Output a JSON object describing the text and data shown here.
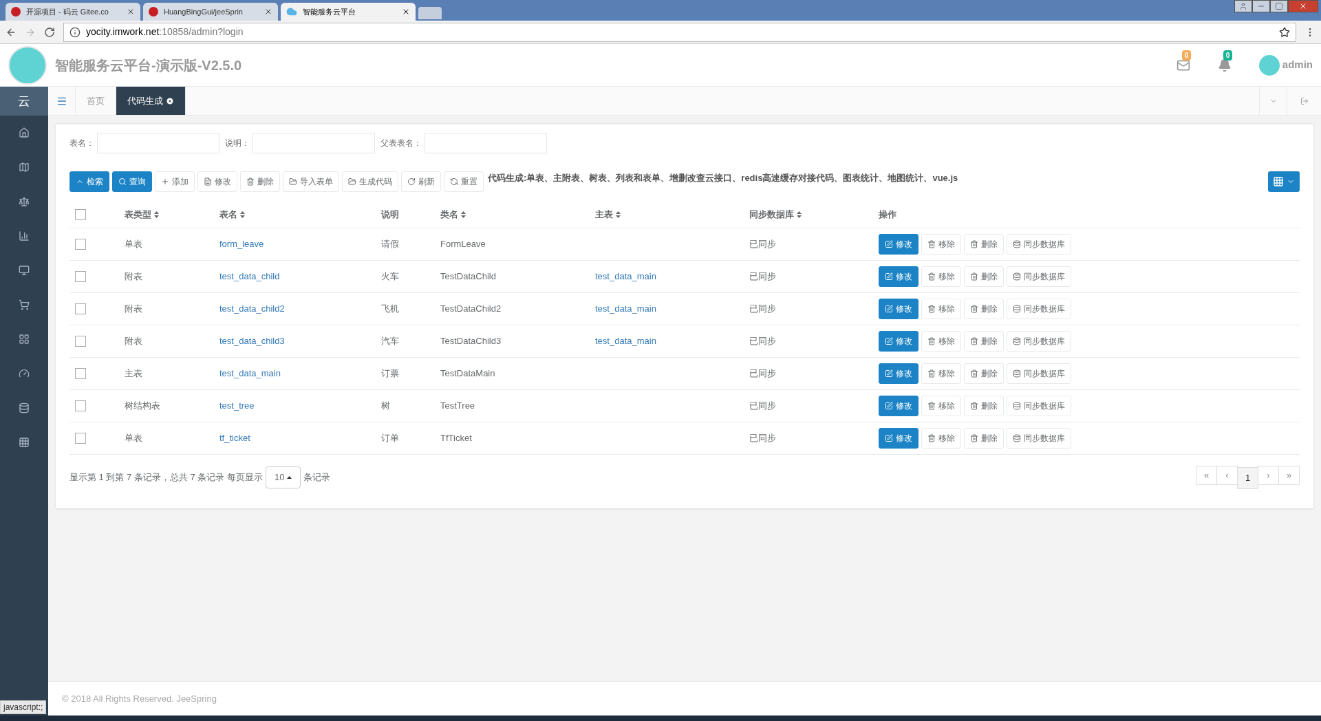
{
  "browser": {
    "tabs": [
      {
        "title": "开源项目 - 码云 Gitee.co",
        "selected": false,
        "kind": "gitee"
      },
      {
        "title": "HuangBingGui/jeeSprin",
        "selected": false,
        "kind": "gitee"
      },
      {
        "title": "智能服务云平台",
        "selected": true,
        "kind": "cloud"
      }
    ],
    "url_host": "yocity.imwork.net",
    "url_rest": ":10858/admin?login"
  },
  "header": {
    "title": "智能服务云平台-演示版-V2.5.0",
    "mail_count": "0",
    "bell_count": "0",
    "user": "admin"
  },
  "sidebar": {
    "brand": "云"
  },
  "page_tabs": [
    {
      "label": "首页",
      "selected": false,
      "closable": false
    },
    {
      "label": "代码生成",
      "selected": true,
      "closable": true
    }
  ],
  "filters": [
    {
      "label": "表名："
    },
    {
      "label": "说明："
    },
    {
      "label": "父表表名："
    }
  ],
  "toolbar": [
    {
      "label": "检索",
      "kind": "primary"
    },
    {
      "label": "查询",
      "kind": "primary"
    },
    {
      "label": "添加",
      "kind": "default"
    },
    {
      "label": "修改",
      "kind": "default"
    },
    {
      "label": "删除",
      "kind": "default"
    },
    {
      "label": "导入表单",
      "kind": "default"
    },
    {
      "label": "生成代码",
      "kind": "default"
    },
    {
      "label": "刷新",
      "kind": "default"
    },
    {
      "label": "重置",
      "kind": "default"
    }
  ],
  "toolbar_note": "代码生成:单表、主附表、树表、列表和表单、增删改查云接口、redis高速缓存对接代码、图表统计、地图统计、vue.js",
  "table": {
    "select_all_checked": false,
    "columns": [
      {
        "label": "表类型",
        "sortable": true
      },
      {
        "label": "表名",
        "sortable": true
      },
      {
        "label": "说明",
        "sortable": false
      },
      {
        "label": "类名",
        "sortable": true
      },
      {
        "label": "主表",
        "sortable": true
      },
      {
        "label": "同步数据库",
        "sortable": true
      },
      {
        "label": "操作",
        "sortable": false
      }
    ],
    "rows": [
      {
        "checked": false,
        "type": "单表",
        "name": "form_leave",
        "comment": "请假",
        "class": "FormLeave",
        "parent": "",
        "sync": "已同步",
        "actions": [
          {
            "label": "修改",
            "kind": "primary"
          },
          {
            "label": "移除",
            "kind": "default"
          },
          {
            "label": "删除",
            "kind": "default"
          },
          {
            "label": "同步数据库",
            "kind": "default"
          }
        ]
      },
      {
        "checked": false,
        "type": "附表",
        "name": "test_data_child",
        "comment": "火车",
        "class": "TestDataChild",
        "parent": "test_data_main",
        "sync": "已同步",
        "actions": [
          {
            "label": "修改",
            "kind": "primary"
          },
          {
            "label": "移除",
            "kind": "default"
          },
          {
            "label": "删除",
            "kind": "default"
          },
          {
            "label": "同步数据库",
            "kind": "default"
          }
        ]
      },
      {
        "checked": false,
        "type": "附表",
        "name": "test_data_child2",
        "comment": "飞机",
        "class": "TestDataChild2",
        "parent": "test_data_main",
        "sync": "已同步",
        "actions": [
          {
            "label": "修改",
            "kind": "primary"
          },
          {
            "label": "移除",
            "kind": "default"
          },
          {
            "label": "删除",
            "kind": "default"
          },
          {
            "label": "同步数据库",
            "kind": "default"
          }
        ]
      },
      {
        "checked": false,
        "type": "附表",
        "name": "test_data_child3",
        "comment": "汽车",
        "class": "TestDataChild3",
        "parent": "test_data_main",
        "sync": "已同步",
        "actions": [
          {
            "label": "修改",
            "kind": "primary"
          },
          {
            "label": "移除",
            "kind": "default"
          },
          {
            "label": "删除",
            "kind": "default"
          },
          {
            "label": "同步数据库",
            "kind": "default"
          }
        ]
      },
      {
        "checked": false,
        "type": "主表",
        "name": "test_data_main",
        "comment": "订票",
        "class": "TestDataMain",
        "parent": "",
        "sync": "已同步",
        "actions": [
          {
            "label": "修改",
            "kind": "primary"
          },
          {
            "label": "移除",
            "kind": "default"
          },
          {
            "label": "删除",
            "kind": "default"
          },
          {
            "label": "同步数据库",
            "kind": "default"
          }
        ]
      },
      {
        "checked": false,
        "type": "树结构表",
        "name": "test_tree",
        "comment": "树",
        "class": "TestTree",
        "parent": "",
        "sync": "已同步",
        "actions": [
          {
            "label": "修改",
            "kind": "primary"
          },
          {
            "label": "移除",
            "kind": "default"
          },
          {
            "label": "删除",
            "kind": "default"
          },
          {
            "label": "同步数据库",
            "kind": "default"
          }
        ]
      },
      {
        "checked": false,
        "type": "单表",
        "name": "tf_ticket",
        "comment": "订单",
        "class": "TfTicket",
        "parent": "",
        "sync": "已同步",
        "actions": [
          {
            "label": "修改",
            "kind": "primary"
          },
          {
            "label": "移除",
            "kind": "default"
          },
          {
            "label": "删除",
            "kind": "default"
          },
          {
            "label": "同步数据库",
            "kind": "default"
          }
        ]
      }
    ]
  },
  "pager": {
    "summary": "显示第 1 到第 7 条记录，总共 7 条记录 每页显示",
    "page_size": "10",
    "suffix": "条记录",
    "buttons": [
      {
        "label": "«",
        "selected": false
      },
      {
        "label": "‹",
        "selected": false
      },
      {
        "label": "1",
        "selected": true
      },
      {
        "label": "›",
        "selected": false
      },
      {
        "label": "»",
        "selected": false
      }
    ]
  },
  "footer": "© 2018 All Rights Reserved. JeeSpring",
  "status": "javascript:;"
}
